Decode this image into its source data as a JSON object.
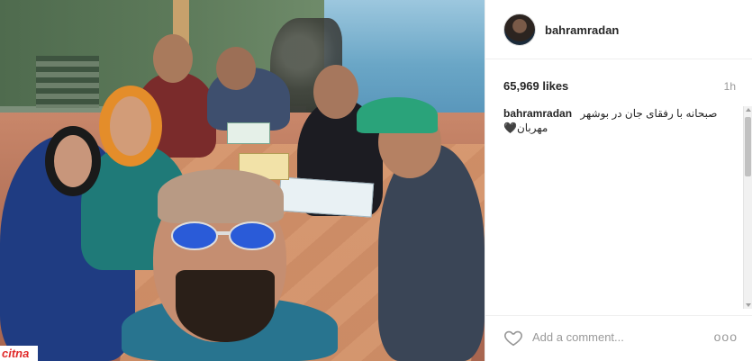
{
  "post": {
    "username": "bahramradan",
    "likes": "65,969 likes",
    "time": "1h",
    "caption_user": "bahramradan",
    "caption_text_line1": "صبحانه با رفقای جان در بوشهر",
    "caption_text_line2": "مهربان🖤"
  },
  "footer": {
    "comment_placeholder": "Add a comment...",
    "more_label": "ooo"
  },
  "watermark": {
    "text": "citna"
  },
  "icons": {
    "heart": "heart-outline-icon",
    "avatar": "user-avatar"
  },
  "colors": {
    "link_text": "#262626",
    "muted": "#999999",
    "divider": "#efefef"
  }
}
